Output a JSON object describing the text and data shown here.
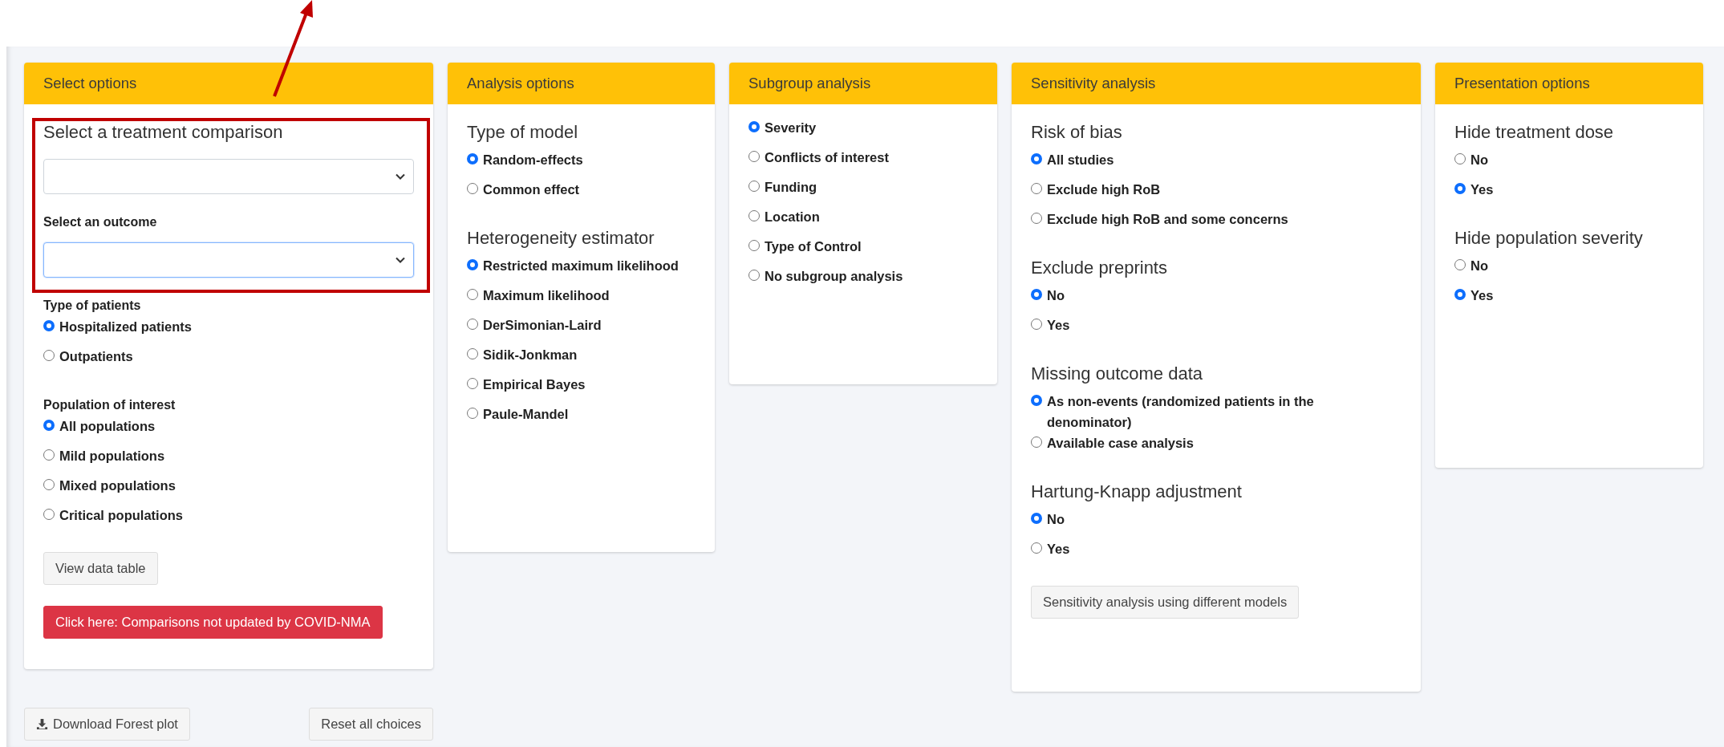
{
  "panels": [
    {
      "title": "Select options",
      "sections": [
        {
          "kind": "heading",
          "text": "Select a treatment comparison"
        },
        {
          "kind": "select",
          "focused": false
        },
        {
          "kind": "label",
          "text": "Select an outcome"
        },
        {
          "kind": "select",
          "focused": true
        },
        {
          "kind": "label",
          "text": "Type of patients"
        },
        {
          "kind": "radios",
          "options": [
            {
              "label": "Hospitalized patients",
              "selected": true
            },
            {
              "label": "Outpatients",
              "selected": false
            }
          ]
        },
        {
          "kind": "label",
          "text": "Population of interest"
        },
        {
          "kind": "radios",
          "options": [
            {
              "label": "All populations",
              "selected": true
            },
            {
              "label": "Mild populations",
              "selected": false
            },
            {
              "label": "Mixed populations",
              "selected": false
            },
            {
              "label": "Critical populations",
              "selected": false
            }
          ]
        },
        {
          "kind": "button",
          "text": "View data table"
        },
        {
          "kind": "alert",
          "text": "Click here: Comparisons not updated by COVID-NMA"
        }
      ]
    },
    {
      "title": "Analysis options",
      "sections": [
        {
          "kind": "heading",
          "text": "Type of model"
        },
        {
          "kind": "radios",
          "options": [
            {
              "label": "Random-effects",
              "selected": true
            },
            {
              "label": "Common effect",
              "selected": false
            }
          ]
        },
        {
          "kind": "heading",
          "text": "Heterogeneity estimator"
        },
        {
          "kind": "radios",
          "options": [
            {
              "label": "Restricted maximum likelihood",
              "selected": true
            },
            {
              "label": "Maximum likelihood",
              "selected": false
            },
            {
              "label": "DerSimonian-Laird",
              "selected": false
            },
            {
              "label": "Sidik-Jonkman",
              "selected": false
            },
            {
              "label": "Empirical Bayes",
              "selected": false
            },
            {
              "label": "Paule-Mandel",
              "selected": false
            }
          ]
        }
      ]
    },
    {
      "title": "Subgroup analysis",
      "sections": [
        {
          "kind": "radios",
          "options": [
            {
              "label": "Severity",
              "selected": true
            },
            {
              "label": "Conflicts of interest",
              "selected": false
            },
            {
              "label": "Funding",
              "selected": false
            },
            {
              "label": "Location",
              "selected": false
            },
            {
              "label": "Type of Control",
              "selected": false
            },
            {
              "label": "No subgroup analysis",
              "selected": false
            }
          ]
        }
      ]
    },
    {
      "title": "Sensitivity analysis",
      "sections": [
        {
          "kind": "heading",
          "text": "Risk of bias"
        },
        {
          "kind": "radios",
          "options": [
            {
              "label": "All studies",
              "selected": true
            },
            {
              "label": "Exclude high RoB",
              "selected": false
            },
            {
              "label": "Exclude high RoB and some concerns",
              "selected": false
            }
          ]
        },
        {
          "kind": "heading",
          "text": "Exclude preprints"
        },
        {
          "kind": "radios",
          "options": [
            {
              "label": "No",
              "selected": true
            },
            {
              "label": "Yes",
              "selected": false
            }
          ]
        },
        {
          "kind": "heading",
          "text": "Missing outcome data"
        },
        {
          "kind": "radios",
          "options": [
            {
              "label": "As non-events (randomized patients in the denominator)",
              "selected": true
            },
            {
              "label": "Available case analysis",
              "selected": false
            }
          ]
        },
        {
          "kind": "heading",
          "text": "Hartung-Knapp adjustment"
        },
        {
          "kind": "radios",
          "options": [
            {
              "label": "No",
              "selected": true
            },
            {
              "label": "Yes",
              "selected": false
            }
          ]
        },
        {
          "kind": "button",
          "text": "Sensitivity analysis using different models"
        }
      ]
    },
    {
      "title": "Presentation options",
      "sections": [
        {
          "kind": "heading",
          "text": "Hide treatment dose"
        },
        {
          "kind": "radios",
          "options": [
            {
              "label": "No",
              "selected": false
            },
            {
              "label": "Yes",
              "selected": true
            }
          ]
        },
        {
          "kind": "heading",
          "text": "Hide population severity"
        },
        {
          "kind": "radios",
          "options": [
            {
              "label": "No",
              "selected": false
            },
            {
              "label": "Yes",
              "selected": true
            }
          ]
        }
      ]
    }
  ],
  "footer_buttons": [
    {
      "label": "Download Forest plot",
      "kind": "download"
    },
    {
      "label": "Reset all choices",
      "kind": "plain"
    }
  ]
}
